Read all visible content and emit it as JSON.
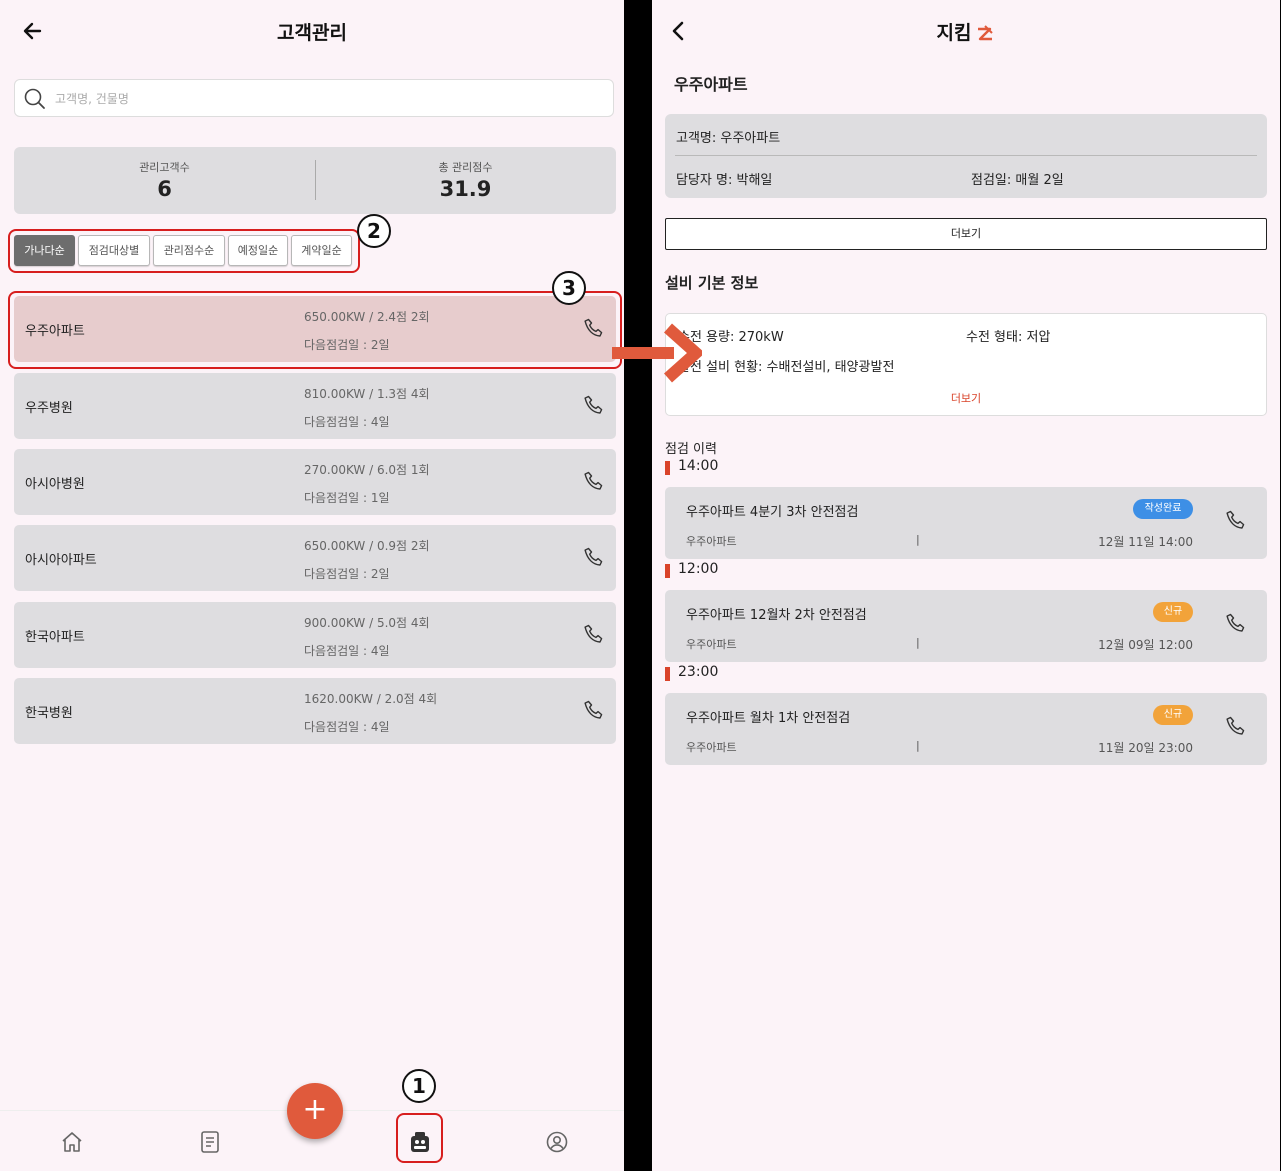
{
  "left": {
    "header_title": "고객관리",
    "search_placeholder": "고객명, 건물명",
    "stats": {
      "customers_label": "관리고객수",
      "customers_value": "6",
      "score_label": "총 관리점수",
      "score_value": "31.9"
    },
    "sort_chips": [
      "가나다순",
      "점검대상별",
      "관리점수순",
      "예정일순",
      "계약일순"
    ],
    "customers": [
      {
        "name": "우주아파트",
        "info": "650.00KW / 2.4점 2회",
        "next": "다음점검일 : 2일"
      },
      {
        "name": "우주병원",
        "info": "810.00KW / 1.3점 4회",
        "next": "다음점검일 : 4일"
      },
      {
        "name": "아시아병원",
        "info": "270.00KW / 6.0점 1회",
        "next": "다음점검일 : 1일"
      },
      {
        "name": "아시아아파트",
        "info": "650.00KW / 0.9점 2회",
        "next": "다음점검일 : 2일"
      },
      {
        "name": "한국아파트",
        "info": "900.00KW / 5.0점 4회",
        "next": "다음점검일 : 4일"
      },
      {
        "name": "한국병원",
        "info": "1620.00KW / 2.0점 4회",
        "next": "다음점검일 : 4일"
      }
    ],
    "fab_label": "+"
  },
  "annotations": {
    "a1": "1",
    "a2": "2",
    "a3": "3"
  },
  "right": {
    "header_title": "지킴",
    "customer_title": "우주아파트",
    "customer_name": "고객명: 우주아파트",
    "manager": "담당자 명: 박해일",
    "inspection_day": "점검일: 매월 2일",
    "more_button": "더보기",
    "equipment_title": "설비 기본 정보",
    "capacity": "수전 용량: 270kW",
    "receiving_type": "수전 형태: 저압",
    "generation": "발전 설비 현황: 수배전설비, 태양광발전",
    "equipment_more": "더보기",
    "history_title": "점검 이력",
    "history": [
      {
        "time": "14:00",
        "title": "우주아파트 4분기 3차 안전점검",
        "site": "우주아파트",
        "sep": "|",
        "date": "12월 11일 14:00",
        "status": "작성완료"
      },
      {
        "time": "12:00",
        "title": "우주아파트 12월차 2차 안전점검",
        "site": "우주아파트",
        "sep": "|",
        "date": "12월 09일 12:00",
        "status": "신규"
      },
      {
        "time": "23:00",
        "title": "우주아파트 월차 1차 안전점검",
        "site": "우주아파트",
        "sep": "|",
        "date": "11월 20일 23:00",
        "status": "신규"
      }
    ]
  },
  "colors": {
    "accent": "#e05a3c",
    "status_done": "#3d8fe6",
    "status_new": "#f2a33a",
    "annotation_red": "#d71e1e"
  },
  "icons": [
    "back-arrow-icon",
    "search-icon",
    "phone-icon",
    "home-icon",
    "document-icon",
    "customers-icon",
    "profile-icon",
    "chevron-left-icon",
    "logo-icon"
  ]
}
